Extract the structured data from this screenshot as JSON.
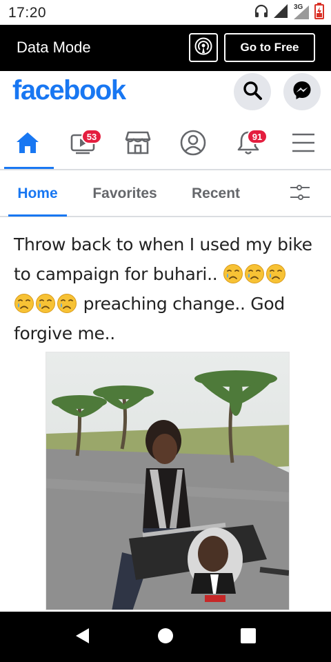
{
  "status": {
    "time": "17:20",
    "network": "3G"
  },
  "data_mode": {
    "title": "Data Mode",
    "go_free": "Go to Free"
  },
  "header": {
    "logo": "facebook",
    "brand_color": "#1877f2"
  },
  "nav": {
    "items": [
      {
        "name": "home",
        "icon": "home-icon",
        "active": true
      },
      {
        "name": "watch",
        "icon": "video-icon",
        "badge": "53"
      },
      {
        "name": "marketplace",
        "icon": "store-icon"
      },
      {
        "name": "profile",
        "icon": "profile-icon"
      },
      {
        "name": "notifications",
        "icon": "bell-icon",
        "badge": "91"
      },
      {
        "name": "menu",
        "icon": "hamburger-icon"
      }
    ]
  },
  "tabs": {
    "home": "Home",
    "favorites": "Favorites",
    "recent": "Recent",
    "active": "Home"
  },
  "post": {
    "line1": "Throw back to when I used my bike",
    "line2": "to campaign for buhari.. ",
    "line3": " preaching change.. God",
    "line4": "forgive me..",
    "emoji": "crying-face",
    "badge_color": "#e41e3f"
  }
}
